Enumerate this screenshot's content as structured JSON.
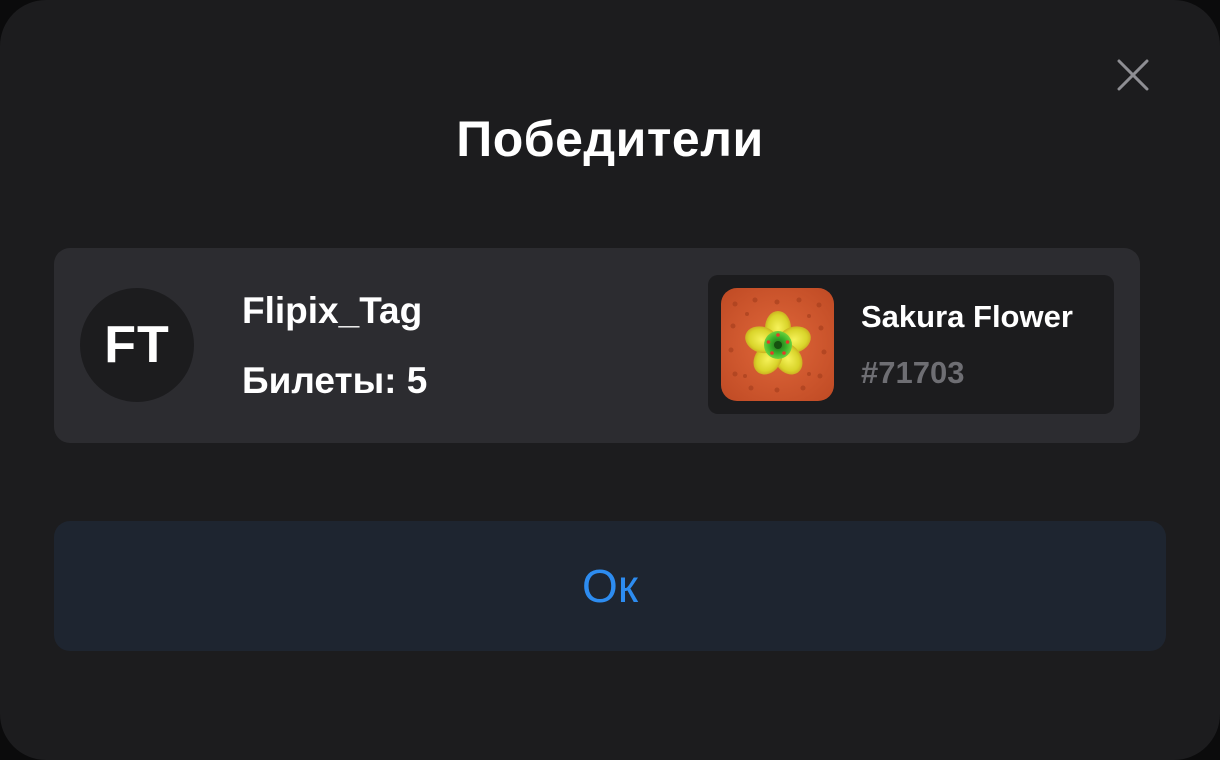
{
  "dialog": {
    "title": "Победители",
    "close_icon": "close-icon",
    "ok_label": "Ок"
  },
  "winner": {
    "initials": "FT",
    "username": "Flipix_Tag",
    "tickets": "Билеты: 5"
  },
  "prize": {
    "name": "Sakura Flower",
    "id": "#71703",
    "image_icon": "sakura-flower-image"
  },
  "colors": {
    "dialog_bg": "#1c1c1e",
    "card_bg": "#2c2c30",
    "prize_bg": "#1c1c1e",
    "ok_button_bg": "#1e2530",
    "accent": "#2d8cf0",
    "muted_text": "#6e6e73",
    "prize_image_bg": "#c8522b"
  }
}
